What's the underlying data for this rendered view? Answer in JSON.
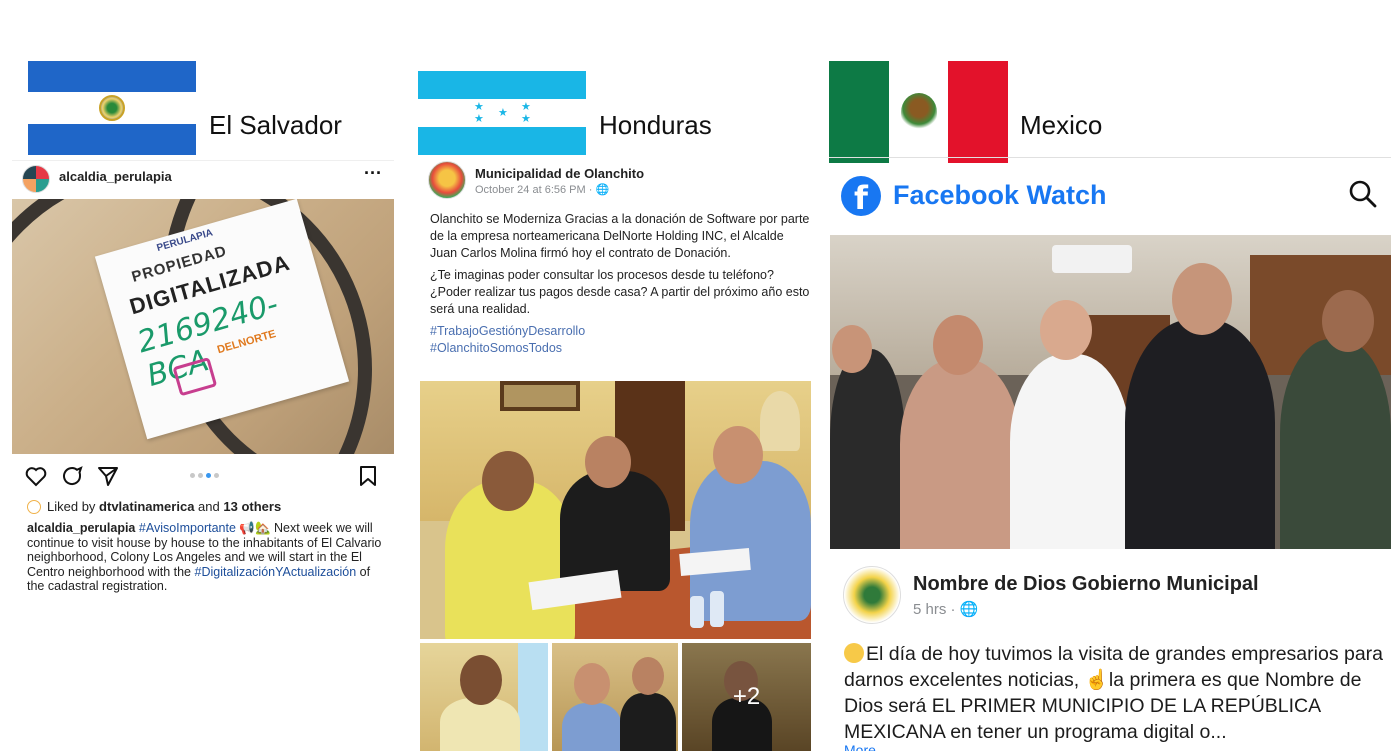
{
  "el_salvador": {
    "country": "El Salvador",
    "post": {
      "username": "alcaldia_perulapia",
      "menu": "···",
      "sticker": {
        "brand": "PERULAPIA",
        "line1": "PROPIEDAD",
        "line2": "DIGITALIZADA",
        "handwritten": "2169240-BCA",
        "logo": "DELNORTE"
      },
      "likes": {
        "prefix": "Liked by",
        "user": "dtvlatinamerica",
        "joiner": "and",
        "others": "13 others"
      },
      "caption": {
        "username": "alcaldia_perulapia",
        "hashtag1": "#AvisoImportante",
        "text": "📢🏡 Next week we will continue to visit house by house to the inhabitants of El Calvario neighborhood, Colony Los Angeles and we will start in the El Centro neighborhood with the",
        "hashtag2": "#DigitalizaciónYActualización",
        "text_end": "of the cadastral registration."
      }
    }
  },
  "honduras": {
    "country": "Honduras",
    "post": {
      "page_name": "Municipalidad de Olanchito",
      "timestamp": "October 24 at 6:56 PM · 🌐",
      "paragraph1": "Olanchito se Moderniza Gracias a la donación de Software por parte de la empresa norteamericana DelNorte Holding INC, el Alcalde Juan Carlos Molina firmó hoy el contrato de Donación.",
      "paragraph2": "¿Te imaginas poder consultar los procesos desde tu teléfono? ¿Poder realizar tus pagos desde casa? A partir del próximo año esto será una realidad.",
      "hashtag1": "#TrabajoGestiónyDesarrollo",
      "hashtag2": "#OlanchitoSomosTodos",
      "more_photos": "+2"
    }
  },
  "mexico": {
    "country": "Mexico",
    "watch_header": "Facebook Watch",
    "post": {
      "page_name": "Nombre de Dios Gobierno Municipal",
      "timestamp": "5 hrs · 🌐",
      "body_part1": "El día de hoy tuvimos la visita de grandes empresarios para darnos excelentes noticias,",
      "body_part2": "la primera es que Nombre de Dios será EL PRIMER MUNICIPIO DE LA REPÚBLICA MEXICANA en tener un programa digital o...",
      "more": "More"
    }
  },
  "colors": {
    "facebook_blue": "#1877f2",
    "hashtag_ig": "#1d4e9a",
    "hashtag_fb": "#4a6fb0",
    "sv_blue": "#1f66c8",
    "hn_cyan": "#19b6e6",
    "mx_green": "#0d7a45",
    "mx_red": "#e3122b"
  }
}
